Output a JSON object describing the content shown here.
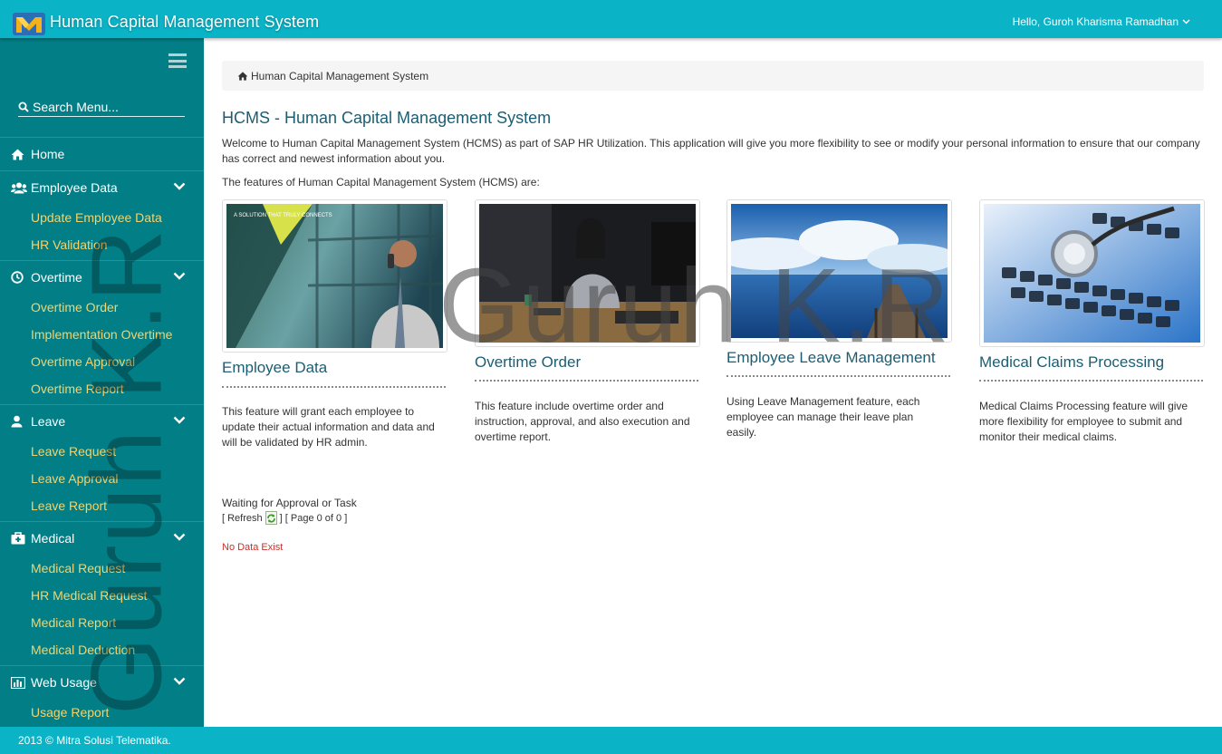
{
  "header": {
    "app_title": "Human Capital Management System",
    "user_greeting": "Hello, Guroh Kharisma Ramadhan"
  },
  "sidebar": {
    "search_placeholder": "Search Menu...",
    "home_label": "Home",
    "groups": [
      {
        "label": "Employee Data",
        "icon": "users-icon",
        "items": [
          "Update Employee Data",
          "HR Validation"
        ]
      },
      {
        "label": "Overtime",
        "icon": "clock-icon",
        "items": [
          "Overtime Order",
          "Implementation Overtime",
          "Overtime Approval",
          "Overtime Report"
        ]
      },
      {
        "label": "Leave",
        "icon": "user-icon",
        "items": [
          "Leave Request",
          "Leave Approval",
          "Leave Report"
        ]
      },
      {
        "label": "Medical",
        "icon": "medkit-icon",
        "items": [
          "Medical Request",
          "HR Medical Request",
          "Medical Report",
          "Medical Deduction"
        ]
      },
      {
        "label": "Web Usage",
        "icon": "bar-chart-icon",
        "items": [
          "Usage Report"
        ]
      }
    ]
  },
  "breadcrumb": {
    "label": "Human Capital Management System"
  },
  "main": {
    "title": "HCMS - Human Capital Management System",
    "intro": "Welcome to Human Capital Management System (HCMS) as part of SAP HR Utilization. This application will give you more flexibility to see or modify your personal information to ensure that our company has correct and newest information about you.",
    "features_lead": "The features of Human Capital Management System (HCMS) are:",
    "features": [
      {
        "title": "Employee Data",
        "description": "This feature will grant each employee to update their actual information and data and will be validated by HR admin.",
        "image_text": "A SOLUTION THAT TRULY CONNECTS"
      },
      {
        "title": "Overtime Order",
        "description": "This feature include overtime order and instruction, approval, and also execution and overtime report."
      },
      {
        "title": "Employee Leave Management",
        "description": "Using Leave Management feature, each employee can manage their leave plan easily."
      },
      {
        "title": "Medical Claims Processing",
        "description": "Medical Claims Processing feature will give more flexibility for employee to submit and monitor their medical claims."
      }
    ],
    "tasks": {
      "title": "Waiting for Approval or Task",
      "refresh_label": "[ Refresh",
      "page_text": "] [ Page 0  of 0 ]",
      "empty_text": "No Data Exist"
    }
  },
  "footer": {
    "text": "2013 © Mitra Solusi Telematika."
  },
  "watermark": {
    "vertical": "Guruh K.R",
    "horizontal": "Guruh K.R"
  },
  "colors": {
    "topbar": "#0bb3c6",
    "sidebar": "#027e86",
    "submenu_text": "#f5d36b",
    "title_text": "#1b5e73",
    "error_text": "#c9302c"
  }
}
